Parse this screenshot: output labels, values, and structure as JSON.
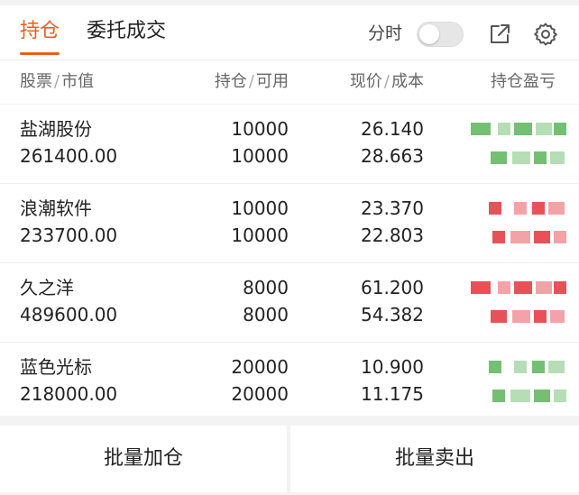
{
  "tabs": [
    {
      "label": "持仓"
    },
    {
      "label": "委托成交"
    }
  ],
  "controls": {
    "fenshi_label": "分时",
    "fenshi_on": false
  },
  "header": {
    "stock": "股票",
    "market_value": "市值",
    "holding": "持仓",
    "available": "可用",
    "current_price": "现价",
    "cost": "成本",
    "profit_loss": "持仓盈亏"
  },
  "rows": [
    {
      "name": "盐湖股份",
      "market_value": "261400.00",
      "holding": "10000",
      "available": "10000",
      "price": "26.140",
      "cost": "28.663",
      "pl_color": "#5ab55a"
    },
    {
      "name": "浪潮软件",
      "market_value": "233700.00",
      "holding": "10000",
      "available": "10000",
      "price": "23.370",
      "cost": "22.803",
      "pl_color": "#e5323c"
    },
    {
      "name": "久之洋",
      "market_value": "489600.00",
      "holding": "8000",
      "available": "8000",
      "price": "61.200",
      "cost": "54.382",
      "pl_color": "#e5323c"
    },
    {
      "name": "蓝色光标",
      "market_value": "218000.00",
      "holding": "20000",
      "available": "20000",
      "price": "10.900",
      "cost": "11.175",
      "pl_color": "#5ab55a"
    }
  ],
  "actions": {
    "batch_add": "批量加仓",
    "batch_sell": "批量卖出"
  },
  "colors": {
    "accent": "#e8601c",
    "up": "#e5323c",
    "down": "#5ab55a"
  },
  "icons": {
    "share": "external-link-icon",
    "settings": "gear-icon"
  }
}
